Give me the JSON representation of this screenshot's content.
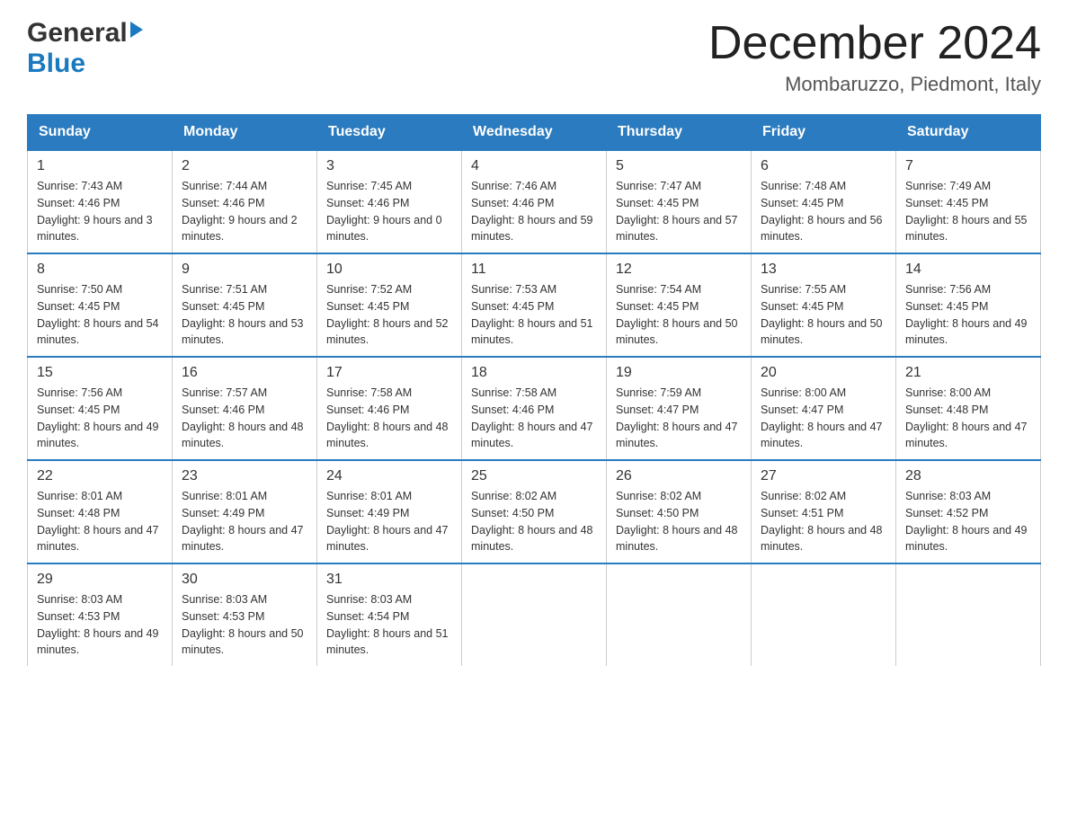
{
  "header": {
    "logo_general": "General",
    "logo_blue": "Blue",
    "title": "December 2024",
    "subtitle": "Mombaruzzo, Piedmont, Italy"
  },
  "days_of_week": [
    "Sunday",
    "Monday",
    "Tuesday",
    "Wednesday",
    "Thursday",
    "Friday",
    "Saturday"
  ],
  "weeks": [
    [
      {
        "day": "1",
        "sunrise": "Sunrise: 7:43 AM",
        "sunset": "Sunset: 4:46 PM",
        "daylight": "Daylight: 9 hours and 3 minutes."
      },
      {
        "day": "2",
        "sunrise": "Sunrise: 7:44 AM",
        "sunset": "Sunset: 4:46 PM",
        "daylight": "Daylight: 9 hours and 2 minutes."
      },
      {
        "day": "3",
        "sunrise": "Sunrise: 7:45 AM",
        "sunset": "Sunset: 4:46 PM",
        "daylight": "Daylight: 9 hours and 0 minutes."
      },
      {
        "day": "4",
        "sunrise": "Sunrise: 7:46 AM",
        "sunset": "Sunset: 4:46 PM",
        "daylight": "Daylight: 8 hours and 59 minutes."
      },
      {
        "day": "5",
        "sunrise": "Sunrise: 7:47 AM",
        "sunset": "Sunset: 4:45 PM",
        "daylight": "Daylight: 8 hours and 57 minutes."
      },
      {
        "day": "6",
        "sunrise": "Sunrise: 7:48 AM",
        "sunset": "Sunset: 4:45 PM",
        "daylight": "Daylight: 8 hours and 56 minutes."
      },
      {
        "day": "7",
        "sunrise": "Sunrise: 7:49 AM",
        "sunset": "Sunset: 4:45 PM",
        "daylight": "Daylight: 8 hours and 55 minutes."
      }
    ],
    [
      {
        "day": "8",
        "sunrise": "Sunrise: 7:50 AM",
        "sunset": "Sunset: 4:45 PM",
        "daylight": "Daylight: 8 hours and 54 minutes."
      },
      {
        "day": "9",
        "sunrise": "Sunrise: 7:51 AM",
        "sunset": "Sunset: 4:45 PM",
        "daylight": "Daylight: 8 hours and 53 minutes."
      },
      {
        "day": "10",
        "sunrise": "Sunrise: 7:52 AM",
        "sunset": "Sunset: 4:45 PM",
        "daylight": "Daylight: 8 hours and 52 minutes."
      },
      {
        "day": "11",
        "sunrise": "Sunrise: 7:53 AM",
        "sunset": "Sunset: 4:45 PM",
        "daylight": "Daylight: 8 hours and 51 minutes."
      },
      {
        "day": "12",
        "sunrise": "Sunrise: 7:54 AM",
        "sunset": "Sunset: 4:45 PM",
        "daylight": "Daylight: 8 hours and 50 minutes."
      },
      {
        "day": "13",
        "sunrise": "Sunrise: 7:55 AM",
        "sunset": "Sunset: 4:45 PM",
        "daylight": "Daylight: 8 hours and 50 minutes."
      },
      {
        "day": "14",
        "sunrise": "Sunrise: 7:56 AM",
        "sunset": "Sunset: 4:45 PM",
        "daylight": "Daylight: 8 hours and 49 minutes."
      }
    ],
    [
      {
        "day": "15",
        "sunrise": "Sunrise: 7:56 AM",
        "sunset": "Sunset: 4:45 PM",
        "daylight": "Daylight: 8 hours and 49 minutes."
      },
      {
        "day": "16",
        "sunrise": "Sunrise: 7:57 AM",
        "sunset": "Sunset: 4:46 PM",
        "daylight": "Daylight: 8 hours and 48 minutes."
      },
      {
        "day": "17",
        "sunrise": "Sunrise: 7:58 AM",
        "sunset": "Sunset: 4:46 PM",
        "daylight": "Daylight: 8 hours and 48 minutes."
      },
      {
        "day": "18",
        "sunrise": "Sunrise: 7:58 AM",
        "sunset": "Sunset: 4:46 PM",
        "daylight": "Daylight: 8 hours and 47 minutes."
      },
      {
        "day": "19",
        "sunrise": "Sunrise: 7:59 AM",
        "sunset": "Sunset: 4:47 PM",
        "daylight": "Daylight: 8 hours and 47 minutes."
      },
      {
        "day": "20",
        "sunrise": "Sunrise: 8:00 AM",
        "sunset": "Sunset: 4:47 PM",
        "daylight": "Daylight: 8 hours and 47 minutes."
      },
      {
        "day": "21",
        "sunrise": "Sunrise: 8:00 AM",
        "sunset": "Sunset: 4:48 PM",
        "daylight": "Daylight: 8 hours and 47 minutes."
      }
    ],
    [
      {
        "day": "22",
        "sunrise": "Sunrise: 8:01 AM",
        "sunset": "Sunset: 4:48 PM",
        "daylight": "Daylight: 8 hours and 47 minutes."
      },
      {
        "day": "23",
        "sunrise": "Sunrise: 8:01 AM",
        "sunset": "Sunset: 4:49 PM",
        "daylight": "Daylight: 8 hours and 47 minutes."
      },
      {
        "day": "24",
        "sunrise": "Sunrise: 8:01 AM",
        "sunset": "Sunset: 4:49 PM",
        "daylight": "Daylight: 8 hours and 47 minutes."
      },
      {
        "day": "25",
        "sunrise": "Sunrise: 8:02 AM",
        "sunset": "Sunset: 4:50 PM",
        "daylight": "Daylight: 8 hours and 48 minutes."
      },
      {
        "day": "26",
        "sunrise": "Sunrise: 8:02 AM",
        "sunset": "Sunset: 4:50 PM",
        "daylight": "Daylight: 8 hours and 48 minutes."
      },
      {
        "day": "27",
        "sunrise": "Sunrise: 8:02 AM",
        "sunset": "Sunset: 4:51 PM",
        "daylight": "Daylight: 8 hours and 48 minutes."
      },
      {
        "day": "28",
        "sunrise": "Sunrise: 8:03 AM",
        "sunset": "Sunset: 4:52 PM",
        "daylight": "Daylight: 8 hours and 49 minutes."
      }
    ],
    [
      {
        "day": "29",
        "sunrise": "Sunrise: 8:03 AM",
        "sunset": "Sunset: 4:53 PM",
        "daylight": "Daylight: 8 hours and 49 minutes."
      },
      {
        "day": "30",
        "sunrise": "Sunrise: 8:03 AM",
        "sunset": "Sunset: 4:53 PM",
        "daylight": "Daylight: 8 hours and 50 minutes."
      },
      {
        "day": "31",
        "sunrise": "Sunrise: 8:03 AM",
        "sunset": "Sunset: 4:54 PM",
        "daylight": "Daylight: 8 hours and 51 minutes."
      },
      null,
      null,
      null,
      null
    ]
  ]
}
